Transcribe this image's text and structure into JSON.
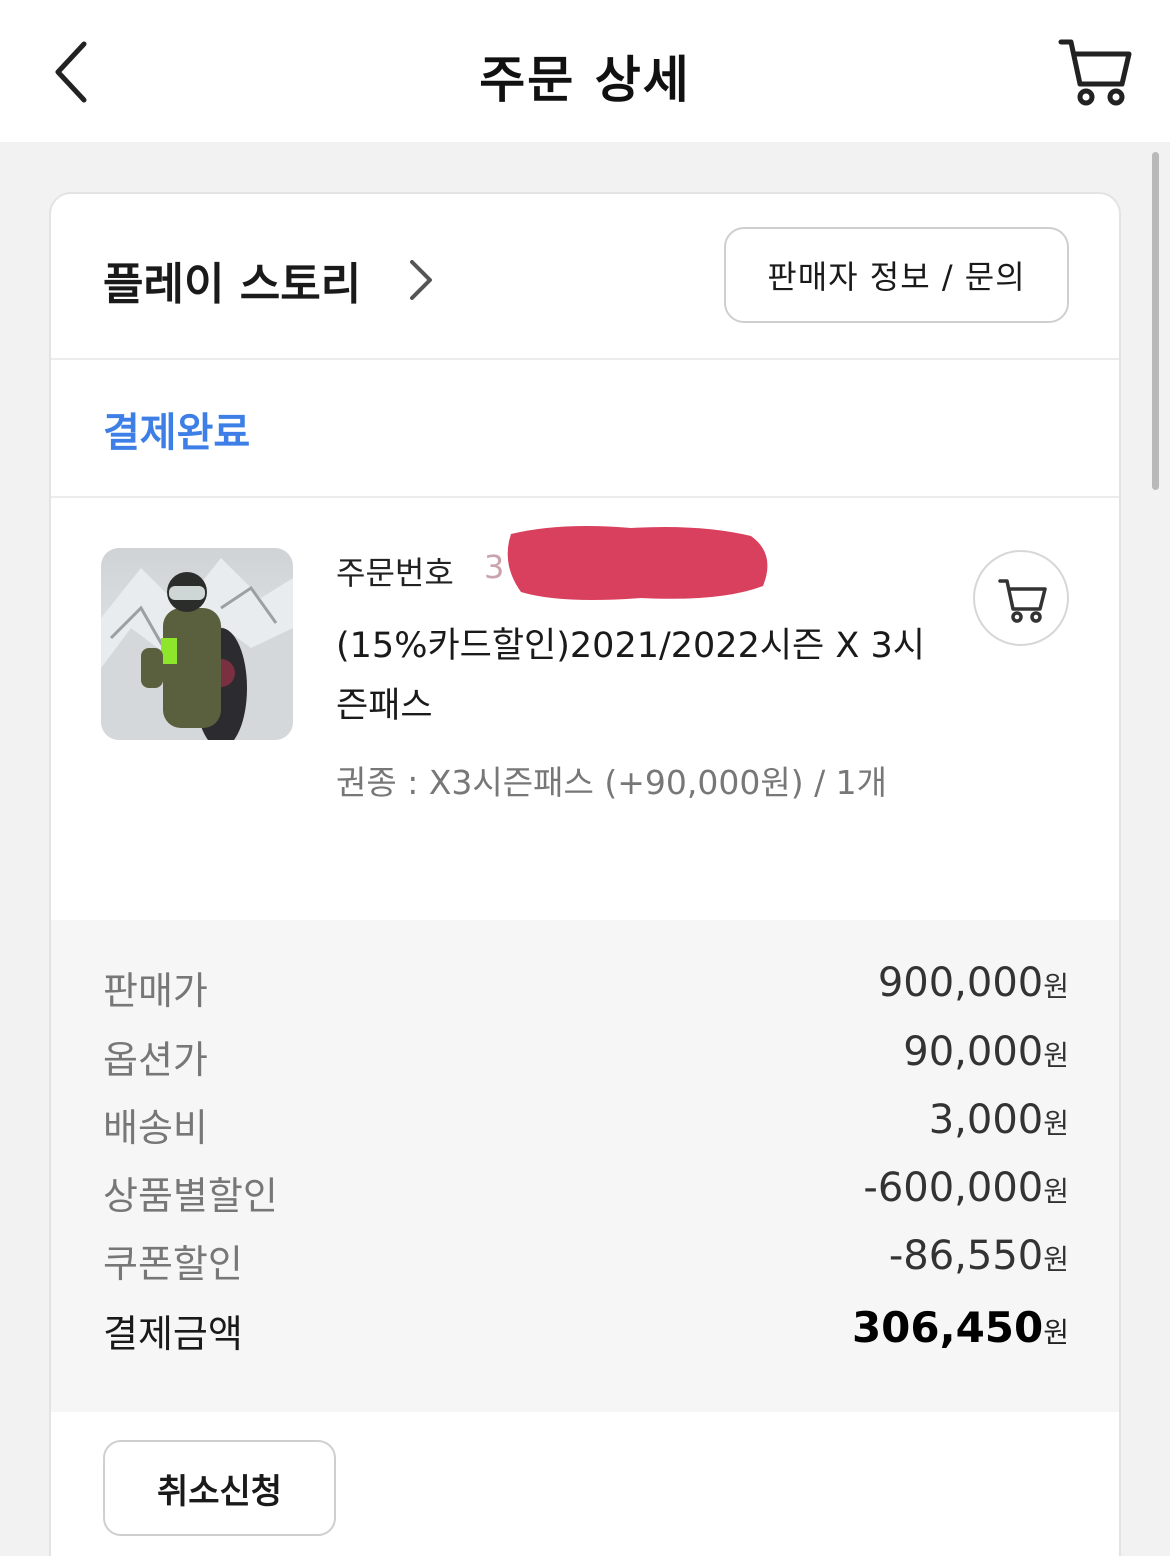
{
  "header": {
    "title": "주문 상세",
    "back_icon": "chevron-left-icon",
    "cart_icon": "cart-icon"
  },
  "seller": {
    "name": "플레이 스토리",
    "info_button": "판매자 정보 / 문의"
  },
  "order_status": "결제완료",
  "status_color": "#3d7fe6",
  "item": {
    "order_no_label": "주문번호",
    "order_no_visible": "3",
    "product_name": "(15%카드할인)2021/2022시즌 X 3시즌패스",
    "option": "권종 : X3시즌패스 (+90,000원) / 1개"
  },
  "prices": {
    "currency": "원",
    "rows": [
      {
        "label": "판매가",
        "value": "900,000"
      },
      {
        "label": "옵션가",
        "value": "90,000"
      },
      {
        "label": "배송비",
        "value": "3,000"
      },
      {
        "label": "상품별할인",
        "value": "-600,000"
      },
      {
        "label": "쿠폰할인",
        "value": "-86,550"
      }
    ],
    "total": {
      "label": "결제금액",
      "value": "306,450"
    }
  },
  "cancel_button": "취소신청"
}
